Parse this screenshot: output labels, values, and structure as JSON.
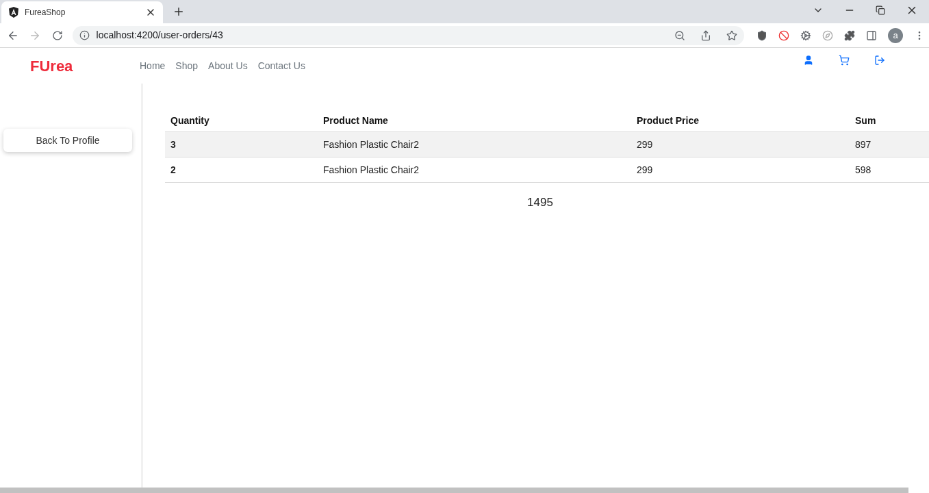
{
  "browser": {
    "tab_title": "FureaShop",
    "url": "localhost:4200/user-orders/43",
    "profile_initial": "a"
  },
  "navbar": {
    "logo": "FUrea",
    "links": [
      "Home",
      "Shop",
      "About Us",
      "Contact Us"
    ]
  },
  "sidebar": {
    "button": "Back To Profile"
  },
  "table": {
    "columns": [
      "Quantity",
      "Product Name",
      "Product Price",
      "Sum"
    ],
    "rows": [
      [
        "3",
        "Fashion Plastic Chair2",
        "299",
        "897"
      ],
      [
        "2",
        "Fashion Plastic Chair2",
        "299",
        "598"
      ]
    ]
  },
  "total": "1495"
}
